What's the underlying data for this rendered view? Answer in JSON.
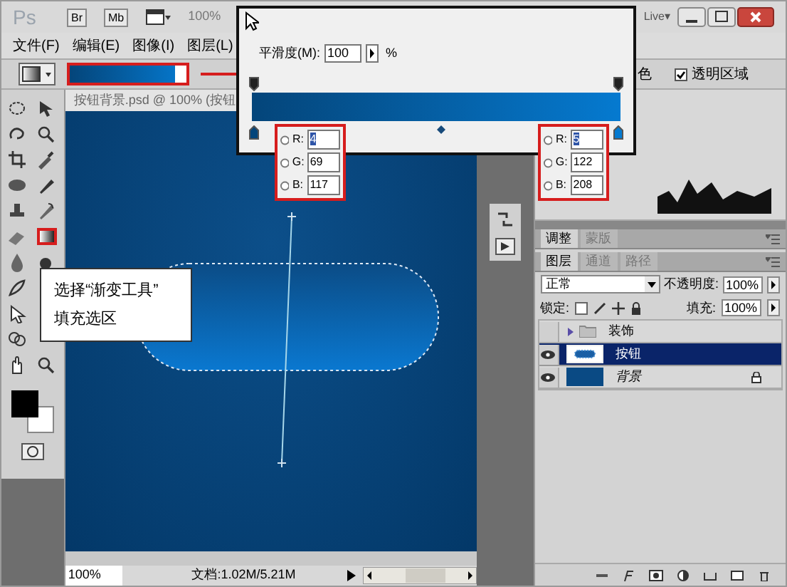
{
  "app_bar": {
    "logo": "Ps",
    "buttons": [
      "Br",
      "Mb"
    ],
    "zoom": "100%",
    "live": "Live▾"
  },
  "menu": [
    "文件(F)",
    "编辑(E)",
    "图像(I)",
    "图层(L)"
  ],
  "options_bar": {
    "partial_label": "色",
    "transparency": {
      "label": "透明区域",
      "checked": true
    }
  },
  "document": {
    "tab": "按钮背景.psd @ 100% (按钮",
    "zoom": "100%",
    "doc_size": "文档:1.02M/5.21M"
  },
  "gradient_editor": {
    "smoothness_label": "平滑度(M):",
    "smoothness": "100",
    "percent": "%",
    "stops": [
      {
        "fields": [
          {
            "label": "R:",
            "value": "4",
            "selected": true,
            "checked": false
          },
          {
            "label": "G:",
            "value": "69",
            "selected": false,
            "checked": false
          },
          {
            "label": "B:",
            "value": "117",
            "selected": false,
            "checked": false
          }
        ]
      },
      {
        "fields": [
          {
            "label": "R:",
            "value": "5",
            "selected": true,
            "checked": false
          },
          {
            "label": "G:",
            "value": "122",
            "selected": false,
            "checked": false
          },
          {
            "label": "B:",
            "value": "208",
            "selected": false,
            "checked": false
          }
        ]
      }
    ]
  },
  "callout": [
    "选择“渐变工具”",
    "填充选区"
  ],
  "adjust_tabs": [
    {
      "label": "调整",
      "selected": true
    },
    {
      "label": "蒙版",
      "selected": false
    }
  ],
  "layer_tabs": [
    {
      "label": "图层",
      "selected": true
    },
    {
      "label": "通道",
      "selected": false
    },
    {
      "label": "路径",
      "selected": false
    }
  ],
  "blend_mode": "正常",
  "opacity_label": "不透明度:",
  "opacity": "100%",
  "lock_label": "锁定:",
  "fill_label": "填充:",
  "fill": "100%",
  "layers": [
    {
      "name": "装饰",
      "kind": "group",
      "visible": false,
      "selected": false,
      "locked": false
    },
    {
      "name": "按钮",
      "kind": "layer",
      "visible": true,
      "selected": true,
      "locked": false
    },
    {
      "name": "背景",
      "kind": "background",
      "visible": true,
      "selected": false,
      "locked": true
    }
  ]
}
